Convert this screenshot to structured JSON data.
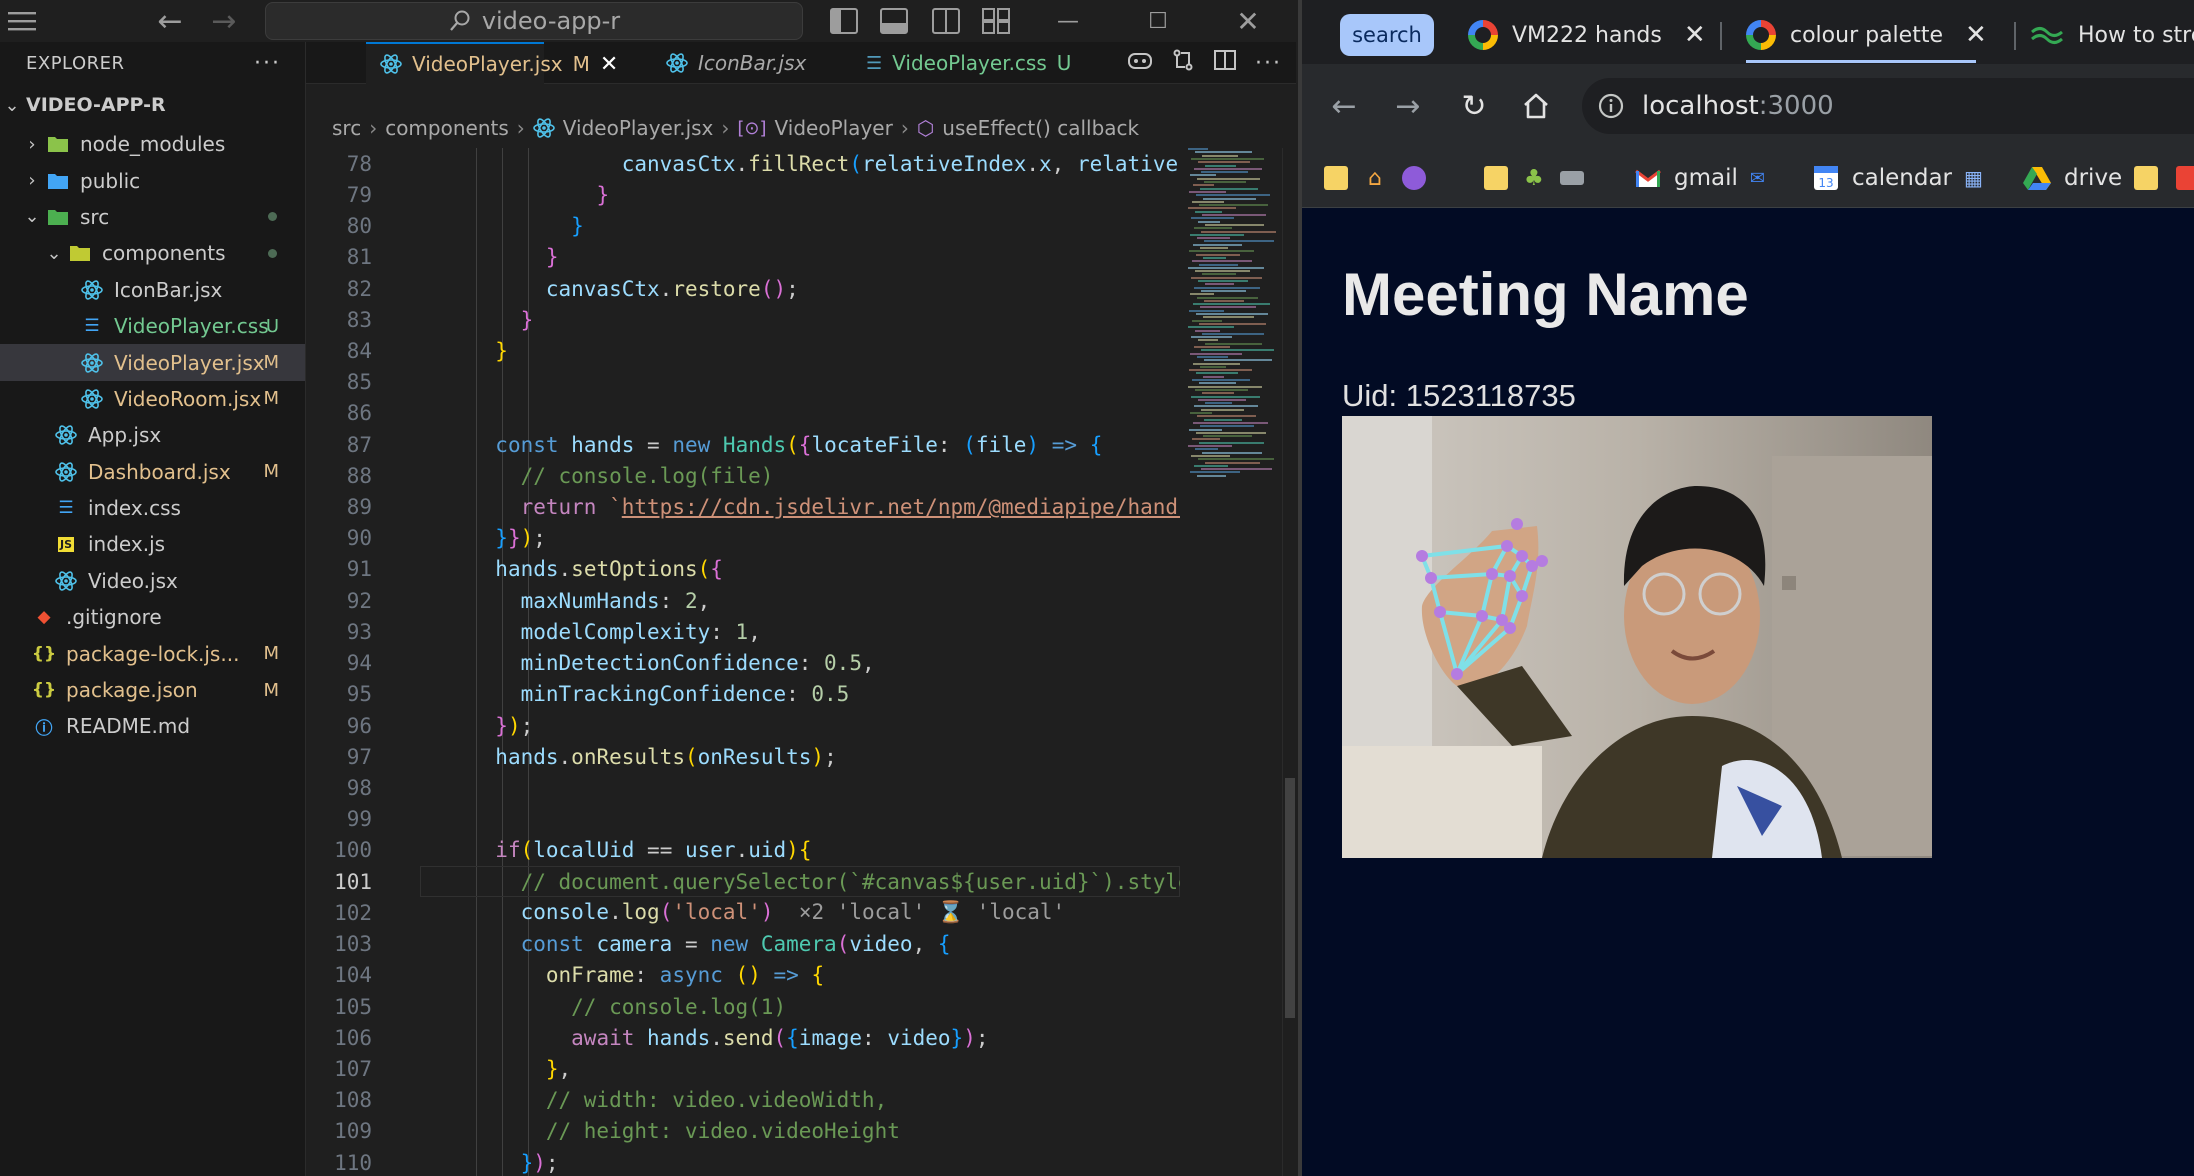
{
  "vscode": {
    "search_text": "video-app-r",
    "explorer_title": "EXPLORER",
    "root_folder": "VIDEO-APP-R",
    "tree": [
      {
        "name": "node_modules",
        "icon": "folder-node-icon",
        "badge": "",
        "level": 1,
        "chevron": ">"
      },
      {
        "name": "public",
        "icon": "folder-public-icon",
        "badge": "",
        "level": 1,
        "chevron": ">"
      },
      {
        "name": "src",
        "icon": "folder-src-icon",
        "badge": "",
        "level": 1,
        "chevron": "v"
      },
      {
        "name": "components",
        "icon": "folder-components-icon",
        "badge": "",
        "level": 2,
        "chevron": "v"
      },
      {
        "name": "IconBar.jsx",
        "icon": "react-icon",
        "badge": "",
        "level": 3
      },
      {
        "name": "VideoPlayer.css",
        "icon": "css-icon",
        "badge": "U",
        "level": 3
      },
      {
        "name": "VideoPlayer.jsx",
        "icon": "react-icon",
        "badge": "M",
        "level": 3
      },
      {
        "name": "VideoRoom.jsx",
        "icon": "react-icon",
        "badge": "M",
        "level": 3
      },
      {
        "name": "App.jsx",
        "icon": "react-icon",
        "badge": "",
        "level": 2
      },
      {
        "name": "Dashboard.jsx",
        "icon": "react-icon",
        "badge": "M",
        "level": 2
      },
      {
        "name": "index.css",
        "icon": "css-icon",
        "badge": "",
        "level": 2
      },
      {
        "name": "index.js",
        "icon": "js-icon",
        "badge": "",
        "level": 2
      },
      {
        "name": "Video.jsx",
        "icon": "react-icon",
        "badge": "",
        "level": 2
      },
      {
        "name": ".gitignore",
        "icon": "git-icon",
        "badge": "",
        "level": 1
      },
      {
        "name": "package-lock.js...",
        "icon": "json-icon",
        "badge": "M",
        "level": 1
      },
      {
        "name": "package.json",
        "icon": "json-icon",
        "badge": "M",
        "level": 1
      },
      {
        "name": "README.md",
        "icon": "info-icon",
        "badge": "",
        "level": 1
      }
    ],
    "tabs": [
      {
        "label": "VideoPlayer.jsx",
        "badge": "M",
        "icon": "react-icon"
      },
      {
        "label": "IconBar.jsx",
        "badge": "",
        "icon": "react-icon"
      },
      {
        "label": "VideoPlayer.css",
        "badge": "U",
        "icon": "css-icon"
      }
    ],
    "breadcrumb": [
      "src",
      "components",
      "VideoPlayer.jsx",
      "VideoPlayer",
      "useEffect() callback"
    ],
    "line_numbers": [
      "78",
      "79",
      "80",
      "81",
      "82",
      "83",
      "84",
      "85",
      "86",
      "87",
      "88",
      "89",
      "90",
      "91",
      "92",
      "93",
      "94",
      "95",
      "96",
      "97",
      "98",
      "99",
      "100",
      "101",
      "102",
      "103",
      "104",
      "105",
      "106",
      "107",
      "108",
      "109",
      "110"
    ],
    "code_url": "https://cdn.jsdelivr.net/npm/@mediapipe/hands/",
    "inline_hint": "×2 'local' ⌛ 'local'"
  },
  "chrome": {
    "search_chip": "search",
    "tabs": [
      {
        "label": "VM222 hands",
        "icon": "google-icon"
      },
      {
        "label": "colour palette",
        "icon": "google-icon"
      },
      {
        "label": "How to stret",
        "icon": "wavy-icon"
      }
    ],
    "url_host": "localhost",
    "url_port": ":3000",
    "bookmarks": [
      {
        "label": "gmail"
      },
      {
        "label": "calendar"
      },
      {
        "label": "drive"
      }
    ]
  },
  "page": {
    "title": "Meeting Name",
    "uid_line": "Uid: 1523118735"
  },
  "colors": {
    "vscode_bg": "#1f1f1f",
    "sidebar_bg": "#181818",
    "accent": "#0078d4",
    "modified": "#e2c08d",
    "untracked": "#73c991",
    "browser_page_bg": "#020b24",
    "search_chip": "#a8c7fa"
  }
}
